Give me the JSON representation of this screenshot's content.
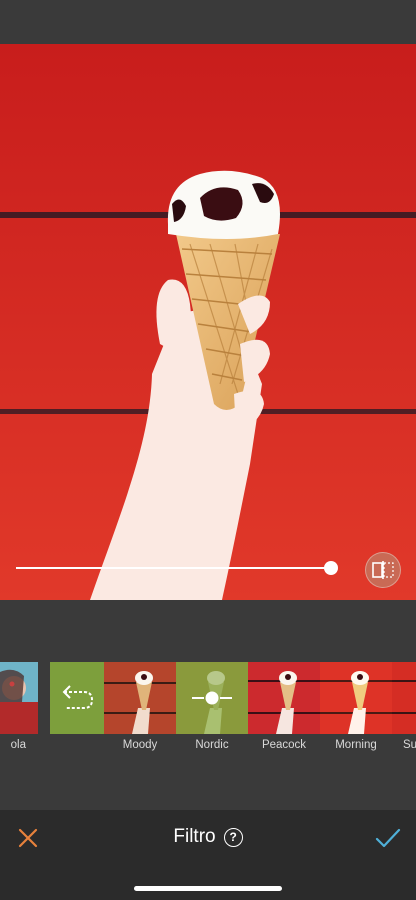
{
  "editor": {
    "title": "Filtro",
    "intensity_fraction": 0.98
  },
  "filters": [
    {
      "label": "ola",
      "icon": "portrait-thumbnail"
    },
    {
      "label": "",
      "icon": "undo-icon"
    },
    {
      "label": "Moody"
    },
    {
      "label": "Nordic",
      "selected": true,
      "icon": "adjust-slider-icon"
    },
    {
      "label": "Peacock"
    },
    {
      "label": "Morning"
    },
    {
      "label": "Su"
    }
  ],
  "colors": {
    "accent_cancel": "#e8823c",
    "accent_confirm": "#4fb0d8",
    "background_red": "#d5241f",
    "selected_tint": "#8ca83e"
  }
}
